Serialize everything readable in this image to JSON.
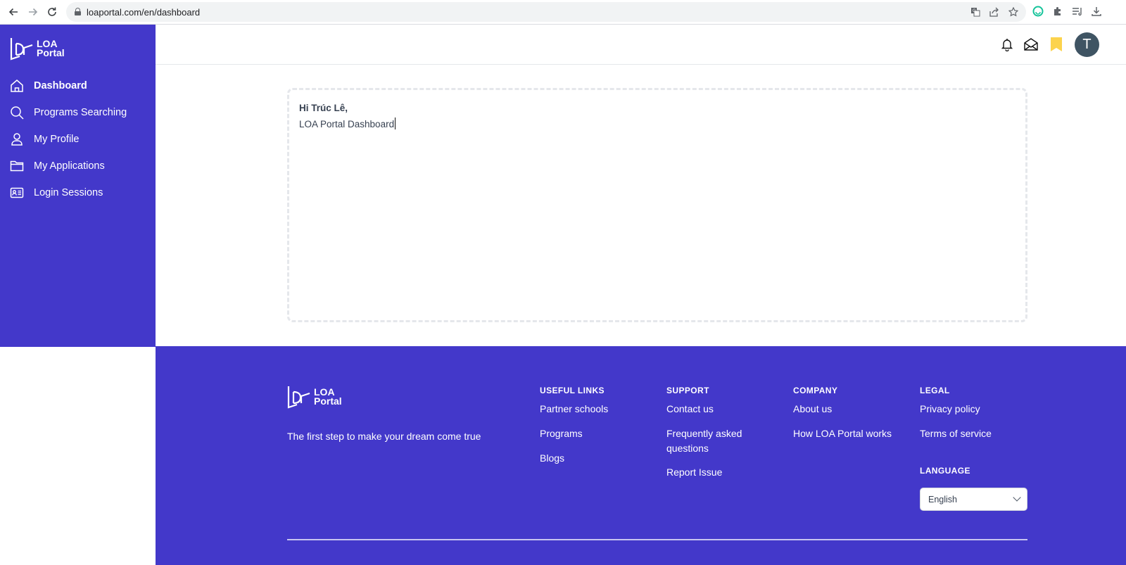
{
  "browser": {
    "url": "loaportal.com/en/dashboard",
    "icons": [
      "back-arrow",
      "forward-arrow",
      "reload",
      "lock",
      "translate",
      "share",
      "bookmark-star",
      "grammarly-extension",
      "extensions-puzzle",
      "reading-list",
      "download"
    ]
  },
  "brand": {
    "line1": "LOA",
    "line2": "Portal",
    "primary_color": "#4338ca"
  },
  "sidebar": {
    "items": [
      {
        "label": "Dashboard",
        "icon": "home-icon",
        "active": true
      },
      {
        "label": "Programs Searching",
        "icon": "search-icon",
        "active": false
      },
      {
        "label": "My Profile",
        "icon": "user-icon",
        "active": false
      },
      {
        "label": "My Applications",
        "icon": "folder-icon",
        "active": false
      },
      {
        "label": "Login Sessions",
        "icon": "id-card-icon",
        "active": false
      }
    ]
  },
  "header": {
    "icons": [
      "bell-icon",
      "envelope-open-icon",
      "bookmark-icon"
    ],
    "avatar_initial": "T",
    "bookmark_color": "#fcd34d",
    "avatar_color": "#3f5463"
  },
  "main": {
    "greeting": "Hi Trúc Lê,",
    "subtitle": "LOA Portal Dashboard"
  },
  "footer": {
    "tagline": "The first step to make your dream come true",
    "columns": [
      {
        "heading": "USEFUL LINKS",
        "links": [
          "Partner schools",
          "Programs",
          "Blogs"
        ]
      },
      {
        "heading": "SUPPORT",
        "links": [
          "Contact us",
          "Frequently asked questions",
          "Report Issue"
        ]
      },
      {
        "heading": "COMPANY",
        "links": [
          "About us",
          "How LOA Portal works"
        ]
      },
      {
        "heading": "LEGAL",
        "links": [
          "Privacy policy",
          "Terms of service"
        ]
      }
    ],
    "language": {
      "heading": "LANGUAGE",
      "selected": "English"
    }
  }
}
